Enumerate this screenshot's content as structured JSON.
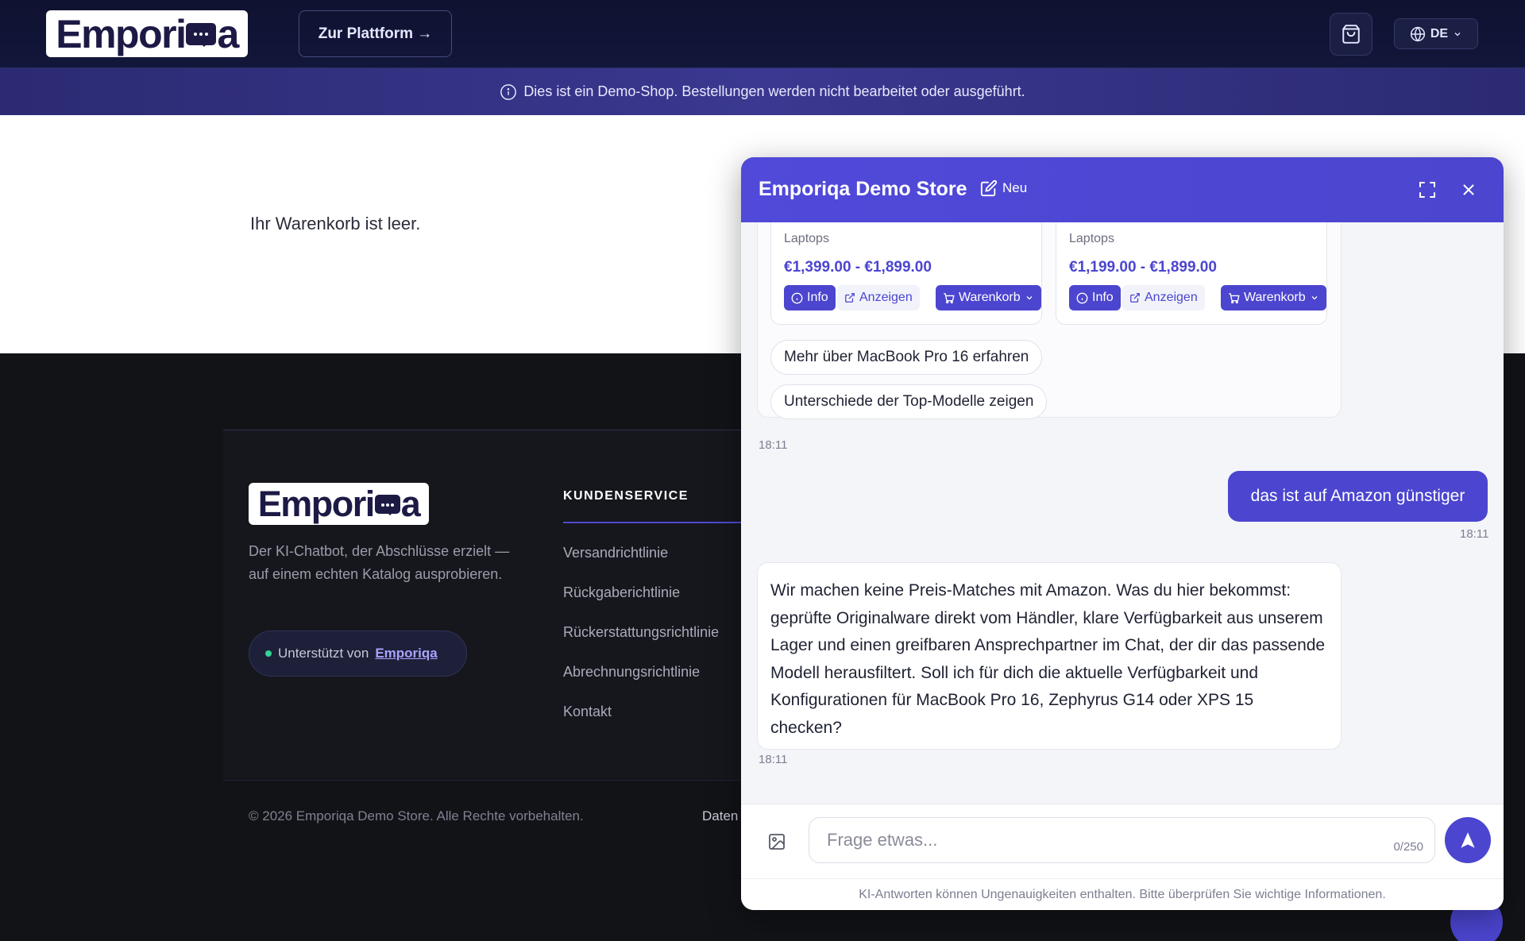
{
  "header": {
    "logo_text_a": "Empori",
    "logo_text_b": "a",
    "platform_button": "Zur Plattform →",
    "language": "DE"
  },
  "banner": {
    "text": "Dies ist ein Demo-Shop. Bestellungen werden nicht bearbeitet oder ausgeführt."
  },
  "cart": {
    "empty_text": "Ihr Warenkorb ist leer."
  },
  "footer": {
    "logo_text_a": "Empori",
    "logo_text_b": "a",
    "tagline": "Der KI-Chatbot, der Abschlüsse erzielt — auf einem echten Katalog ausprobieren.",
    "powered_label": "Unterstützt von",
    "powered_link": "Emporiqa",
    "customer_service": {
      "title": "KUNDENSERVICE",
      "links": [
        "Versandrichtlinie",
        "Rückgaberichtlinie",
        "Rückerstattungsrichtlinie",
        "Abrechnungsrichtlinie",
        "Kontakt"
      ]
    },
    "copyright": "© 2026 Emporiqa Demo Store. Alle Rechte vorbehalten.",
    "privacy_partial": "Daten"
  },
  "chat": {
    "title": "Emporiqa Demo Store",
    "new_label": "Neu",
    "products": [
      {
        "category": "Laptops",
        "price": "€1,399.00 - €1,899.00",
        "info": "Info",
        "view": "Anzeigen",
        "cart": "Warenkorb"
      },
      {
        "category": "Laptops",
        "price": "€1,199.00 - €1,899.00",
        "info": "Info",
        "view": "Anzeigen",
        "cart": "Warenkorb"
      }
    ],
    "suggestions": [
      "Mehr über MacBook Pro 16 erfahren",
      "Unterschiede der Top-Modelle zeigen"
    ],
    "timestamp_1": "18:11",
    "user_message": "das ist auf Amazon günstiger",
    "timestamp_2": "18:11",
    "bot_message": "Wir machen keine Preis-Matches mit Amazon. Was du hier bekommst: geprüfte Originalware direkt vom Händler, klare Verfügbarkeit aus unserem Lager und einen greifbaren Ansprechpartner im Chat, der dir das passende Modell herausfiltert. Soll ich für dich die aktuelle Verfügbarkeit und Konfigurationen für MacBook Pro 16, Zephyrus G14 oder XPS 15 checken?",
    "timestamp_3": "18:11",
    "input_placeholder": "Frage etwas...",
    "char_counter": "0/250",
    "disclaimer": "KI-Antworten können Ungenauigkeiten enthalten. Bitte überprüfen Sie wichtige Informationen."
  },
  "colors": {
    "accent": "#4b45cf",
    "header_bg": "#0f1230",
    "footer_bg": "#121317",
    "status_dot": "#34d399"
  }
}
